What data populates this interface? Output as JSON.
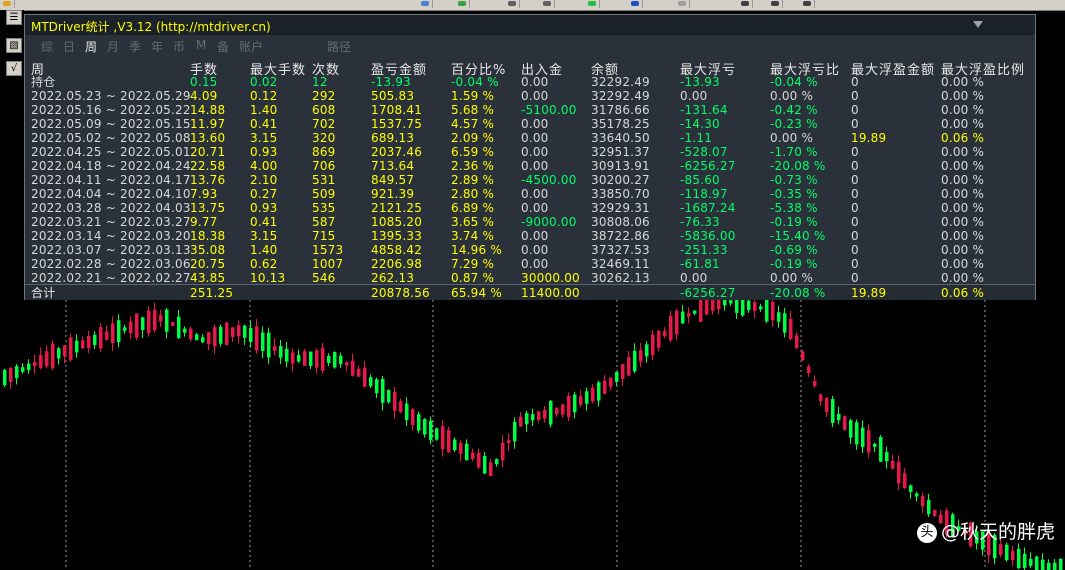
{
  "panel": {
    "title": "MTDriver统计 ,V3.12 (http://mtdriver.cn)",
    "tabs": [
      {
        "label": "综",
        "active": false
      },
      {
        "label": "日",
        "active": false
      },
      {
        "label": "周",
        "active": true
      },
      {
        "label": "月",
        "active": false
      },
      {
        "label": "季",
        "active": false
      },
      {
        "label": "年",
        "active": false
      },
      {
        "label": "币",
        "active": false
      },
      {
        "label": "M",
        "active": false
      },
      {
        "label": "备",
        "active": false
      },
      {
        "label": "账户",
        "active": false
      },
      {
        "label": "路径",
        "active": false
      }
    ],
    "columns": [
      "周",
      "手数",
      "最大手数",
      "次数",
      "盈亏金额",
      "百分比%",
      "出入金",
      "余额",
      "最大浮亏",
      "最大浮亏比",
      "最大浮盈金额",
      "最大浮盈比例"
    ],
    "holding": {
      "period": "持仓",
      "lots": "0.15",
      "max_lots": "0.02",
      "count": "12",
      "pnl": "-13.93",
      "pct": "-0.04 %",
      "flow": "0.00",
      "balance": "32292.49",
      "max_float_loss": "-13.93",
      "max_float_loss_pct": "-0.04 %",
      "max_float_profit": "0",
      "max_float_profit_pct": "0.00 %"
    },
    "rows": [
      {
        "period": "2022.05.23 ~ 2022.05.29",
        "lots": "4.09",
        "max_lots": "0.12",
        "count": "292",
        "pnl": "505.83",
        "pct": "1.59 %",
        "flow": "0.00",
        "balance": "32292.49",
        "max_float_loss": "0.00",
        "max_float_loss_pct": "0.00 %",
        "max_float_profit": "0",
        "max_float_profit_pct": "0.00 %"
      },
      {
        "period": "2022.05.16 ~ 2022.05.22",
        "lots": "14.88",
        "max_lots": "1.40",
        "count": "608",
        "pnl": "1708.41",
        "pct": "5.68 %",
        "flow": "-5100.00",
        "balance": "31786.66",
        "max_float_loss": "-131.64",
        "max_float_loss_pct": "-0.42 %",
        "max_float_profit": "0",
        "max_float_profit_pct": "0.00 %"
      },
      {
        "period": "2022.05.09 ~ 2022.05.15",
        "lots": "11.97",
        "max_lots": "0.41",
        "count": "702",
        "pnl": "1537.75",
        "pct": "4.57 %",
        "flow": "0.00",
        "balance": "35178.25",
        "max_float_loss": "-14.30",
        "max_float_loss_pct": "-0.23 %",
        "max_float_profit": "0",
        "max_float_profit_pct": "0.00 %"
      },
      {
        "period": "2022.05.02 ~ 2022.05.08",
        "lots": "13.60",
        "max_lots": "3.15",
        "count": "320",
        "pnl": "689.13",
        "pct": "2.09 %",
        "flow": "0.00",
        "balance": "33640.50",
        "max_float_loss": "-1.11",
        "max_float_loss_pct": "0.00 %",
        "max_float_profit": "19.89",
        "max_float_profit_pct": "0.06 %"
      },
      {
        "period": "2022.04.25 ~ 2022.05.01",
        "lots": "20.71",
        "max_lots": "0.93",
        "count": "869",
        "pnl": "2037.46",
        "pct": "6.59 %",
        "flow": "0.00",
        "balance": "32951.37",
        "max_float_loss": "-528.07",
        "max_float_loss_pct": "-1.70 %",
        "max_float_profit": "0",
        "max_float_profit_pct": "0.00 %"
      },
      {
        "period": "2022.04.18 ~ 2022.04.24",
        "lots": "22.58",
        "max_lots": "4.00",
        "count": "706",
        "pnl": "713.64",
        "pct": "2.36 %",
        "flow": "0.00",
        "balance": "30913.91",
        "max_float_loss": "-6256.27",
        "max_float_loss_pct": "-20.08 %",
        "max_float_profit": "0",
        "max_float_profit_pct": "0.00 %"
      },
      {
        "period": "2022.04.11 ~ 2022.04.17",
        "lots": "13.76",
        "max_lots": "2.10",
        "count": "531",
        "pnl": "849.57",
        "pct": "2.89 %",
        "flow": "-4500.00",
        "balance": "30200.27",
        "max_float_loss": "-85.60",
        "max_float_loss_pct": "-0.73 %",
        "max_float_profit": "0",
        "max_float_profit_pct": "0.00 %"
      },
      {
        "period": "2022.04.04 ~ 2022.04.10",
        "lots": "7.93",
        "max_lots": "0.27",
        "count": "509",
        "pnl": "921.39",
        "pct": "2.80 %",
        "flow": "0.00",
        "balance": "33850.70",
        "max_float_loss": "-118.97",
        "max_float_loss_pct": "-0.35 %",
        "max_float_profit": "0",
        "max_float_profit_pct": "0.00 %"
      },
      {
        "period": "2022.03.28 ~ 2022.04.03",
        "lots": "13.75",
        "max_lots": "0.93",
        "count": "535",
        "pnl": "2121.25",
        "pct": "6.89 %",
        "flow": "0.00",
        "balance": "32929.31",
        "max_float_loss": "-1687.24",
        "max_float_loss_pct": "-5.38 %",
        "max_float_profit": "0",
        "max_float_profit_pct": "0.00 %"
      },
      {
        "period": "2022.03.21 ~ 2022.03.27",
        "lots": "9.77",
        "max_lots": "0.41",
        "count": "587",
        "pnl": "1085.20",
        "pct": "3.65 %",
        "flow": "-9000.00",
        "balance": "30808.06",
        "max_float_loss": "-76.33",
        "max_float_loss_pct": "-0.19 %",
        "max_float_profit": "0",
        "max_float_profit_pct": "0.00 %"
      },
      {
        "period": "2022.03.14 ~ 2022.03.20",
        "lots": "18.38",
        "max_lots": "3.15",
        "count": "715",
        "pnl": "1395.33",
        "pct": "3.74 %",
        "flow": "0.00",
        "balance": "38722.86",
        "max_float_loss": "-5836.00",
        "max_float_loss_pct": "-15.40 %",
        "max_float_profit": "0",
        "max_float_profit_pct": "0.00 %"
      },
      {
        "period": "2022.03.07 ~ 2022.03.13",
        "lots": "35.08",
        "max_lots": "1.40",
        "count": "1573",
        "pnl": "4858.42",
        "pct": "14.96 %",
        "flow": "0.00",
        "balance": "37327.53",
        "max_float_loss": "-251.33",
        "max_float_loss_pct": "-0.69 %",
        "max_float_profit": "0",
        "max_float_profit_pct": "0.00 %"
      },
      {
        "period": "2022.02.28 ~ 2022.03.06",
        "lots": "20.75",
        "max_lots": "0.62",
        "count": "1007",
        "pnl": "2206.98",
        "pct": "7.29 %",
        "flow": "0.00",
        "balance": "32469.11",
        "max_float_loss": "-61.81",
        "max_float_loss_pct": "-0.19 %",
        "max_float_profit": "0",
        "max_float_profit_pct": "0.00 %"
      },
      {
        "period": "2022.02.21 ~ 2022.02.27",
        "lots": "43.85",
        "max_lots": "10.13",
        "count": "546",
        "pnl": "262.13",
        "pct": "0.87 %",
        "flow": "30000.00",
        "balance": "30262.13",
        "max_float_loss": "0.00",
        "max_float_loss_pct": "0.00 %",
        "max_float_profit": "0",
        "max_float_profit_pct": "0.00 %"
      }
    ],
    "total": {
      "period": "合计",
      "lots": "251.25",
      "pnl": "20878.56",
      "pct": "65.94 %",
      "flow": "11400.00",
      "max_float_loss": "-6256.27",
      "max_float_loss_pct": "-20.08 %",
      "max_float_profit": "19.89",
      "max_float_profit_pct": "0.06 %"
    }
  },
  "watermark": {
    "logo_text": "头",
    "handle": "@秋天的胖虎"
  },
  "left_buttons": [
    "☰",
    "▧",
    "√"
  ],
  "colors": {
    "positive": "#ffff00",
    "negative": "#00ff66",
    "neutral": "#d8d8d8",
    "candle_up": "#00ff40",
    "candle_down": "#e8194a",
    "panel_bg": "#2a313a"
  }
}
